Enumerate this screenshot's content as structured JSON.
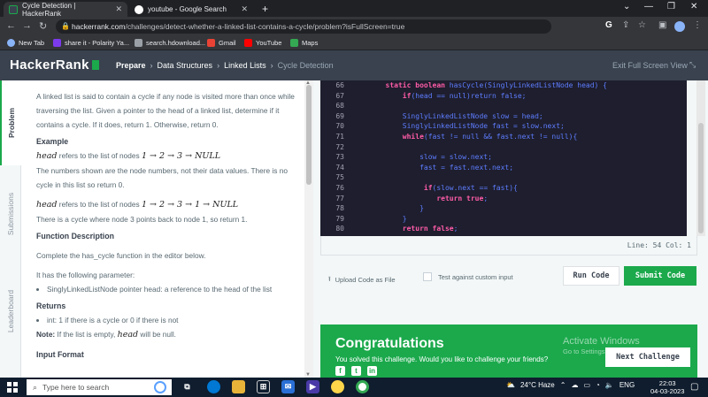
{
  "browser": {
    "tabs": [
      {
        "title": "Cycle Detection | HackerRank",
        "active": true,
        "favicon_color": "#39424e"
      },
      {
        "title": "youtube - Google Search",
        "active": false,
        "favicon_color": "#ffffff"
      }
    ],
    "new_tab": "+",
    "url_host": "hackerrank.com",
    "url_path": "/challenges/detect-whether-a-linked-list-contains-a-cycle/problem?isFullScreen=true",
    "bookmarks": [
      {
        "label": "New Tab",
        "color": "#8ab4f8"
      },
      {
        "label": "share it - Polarity Ya...",
        "color": "#7c3aed"
      },
      {
        "label": "search.hdownload...",
        "color": "#9aa0a6"
      },
      {
        "label": "Gmail",
        "color": "#ea4335"
      },
      {
        "label": "YouTube",
        "color": "#ff0000"
      },
      {
        "label": "Maps",
        "color": "#34a853"
      }
    ]
  },
  "header": {
    "logo": "HackerRank",
    "breadcrumbs": [
      "Prepare",
      "Data Structures",
      "Linked Lists",
      "Cycle Detection"
    ],
    "exit_fullscreen": "Exit Full Screen View"
  },
  "sidebar_tabs": [
    "Problem",
    "Submissions",
    "Leaderboard"
  ],
  "problem": {
    "intro": "A linked list is said to contain a cycle if any node is visited more than once while traversing the list. Given a pointer to the head of a linked list, determine if it contains a cycle. If it does, return 1. Otherwise, return 0.",
    "example_heading": "Example",
    "ex1_var": "head",
    "ex1_text": " refers to the list of nodes ",
    "ex1_math": "1 → 2 → 3 → NULL",
    "ex1_desc": "The numbers shown are the node numbers, not their data values. There is no cycle in this list so return 0.",
    "ex2_var": "head",
    "ex2_text": " refers to the list of nodes ",
    "ex2_math": "1 → 2 → 3 → 1 → NULL",
    "ex2_desc": "There is a cycle where node 3 points back to node 1, so return 1.",
    "function_heading": "Function Description",
    "function_desc": "Complete the has_cycle function in the editor below.",
    "param_intro": "It has the following parameter:",
    "param_item": "SinglyLinkedListNode pointer head: a reference to the head of the list",
    "returns_heading": "Returns",
    "returns_item": "int: 1 if there is a cycle or 0 if there is not",
    "note_label": "Note:",
    "note_text": " If the list is empty, ",
    "note_var": "head",
    "note_end": " will be null.",
    "input_heading": "Input Format"
  },
  "editor": {
    "lines": [
      {
        "n": "66",
        "pre": "        ",
        "kw": "static boolean ",
        "rest": "hasCycle(SinglyLinkedListNode head) {"
      },
      {
        "n": "67",
        "pre": "            ",
        "kw": "if",
        "rest": "(head == null)return false;"
      },
      {
        "n": "68",
        "pre": "",
        "kw": "",
        "rest": ""
      },
      {
        "n": "69",
        "pre": "            ",
        "kw": "",
        "rest": "SinglyLinkedListNode slow = head;"
      },
      {
        "n": "70",
        "pre": "            ",
        "kw": "",
        "rest": "SinglyLinkedListNode fast = slow.next;"
      },
      {
        "n": "71",
        "pre": "            ",
        "kw": "while",
        "rest": "(fast != null && fast.next != null){"
      },
      {
        "n": "72",
        "pre": "",
        "kw": "",
        "rest": ""
      },
      {
        "n": "73",
        "pre": "                ",
        "kw": "",
        "rest": "slow = slow.next;"
      },
      {
        "n": "74",
        "pre": "                ",
        "kw": "",
        "rest": "fast = fast.next.next;"
      },
      {
        "n": "75",
        "pre": "",
        "kw": "",
        "rest": ""
      },
      {
        "n": "76",
        "pre": "                 ",
        "kw": "if",
        "rest": "(slow.next == fast){"
      },
      {
        "n": "77",
        "pre": "                    ",
        "kw": "return true",
        "rest": ";"
      },
      {
        "n": "78",
        "pre": "                }",
        "kw": "",
        "rest": ""
      },
      {
        "n": "79",
        "pre": "            }",
        "kw": "",
        "rest": ""
      },
      {
        "n": "80",
        "pre": "            ",
        "kw": "return false",
        "rest": ";"
      }
    ],
    "status": "Line: 54 Col: 1"
  },
  "actions": {
    "upload": "Upload Code as File",
    "custom_input": "Test against custom input",
    "run": "Run Code",
    "submit": "Submit Code"
  },
  "congrats": {
    "title": "Congratulations",
    "message": "You solved this challenge. Would you like to challenge your friends?",
    "next": "Next Challenge"
  },
  "watermark": {
    "line1": "Activate Windows",
    "line2": "Go to Settings to activate Windows."
  },
  "taskbar": {
    "search_placeholder": "Type here to search",
    "weather": "24°C  Haze",
    "lang": "ENG",
    "time": "22:03",
    "date": "04-03-2023"
  },
  "colors": {
    "accent": "#1ba94c",
    "header": "#39424e",
    "editor_bg": "#1e1e2e"
  }
}
